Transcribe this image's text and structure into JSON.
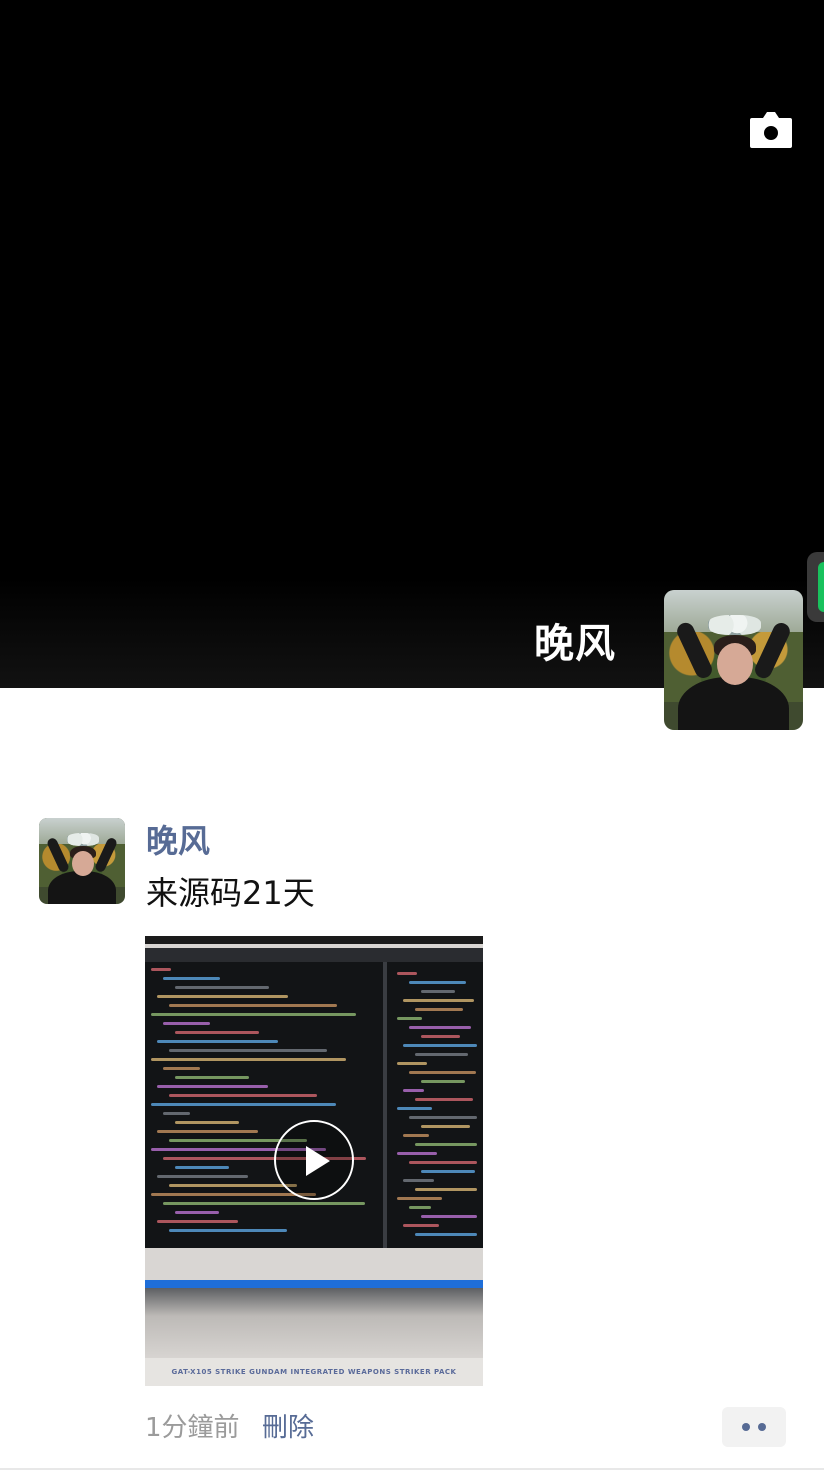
{
  "cover": {
    "username": "晚风"
  },
  "post": {
    "author": "晚风",
    "text": "来源码21天",
    "video_caption": "GAT-X105 STRIKE GUNDAM INTEGRATED WEAPONS STRIKER PACK",
    "time": "1分鐘前",
    "delete_label": "刪除"
  },
  "colors": {
    "link": "#576b95",
    "meta": "#9b9b9b",
    "accent_green": "#19c25d"
  },
  "icons": {
    "camera": "camera-icon",
    "play": "play-icon",
    "more": "more-icon"
  }
}
